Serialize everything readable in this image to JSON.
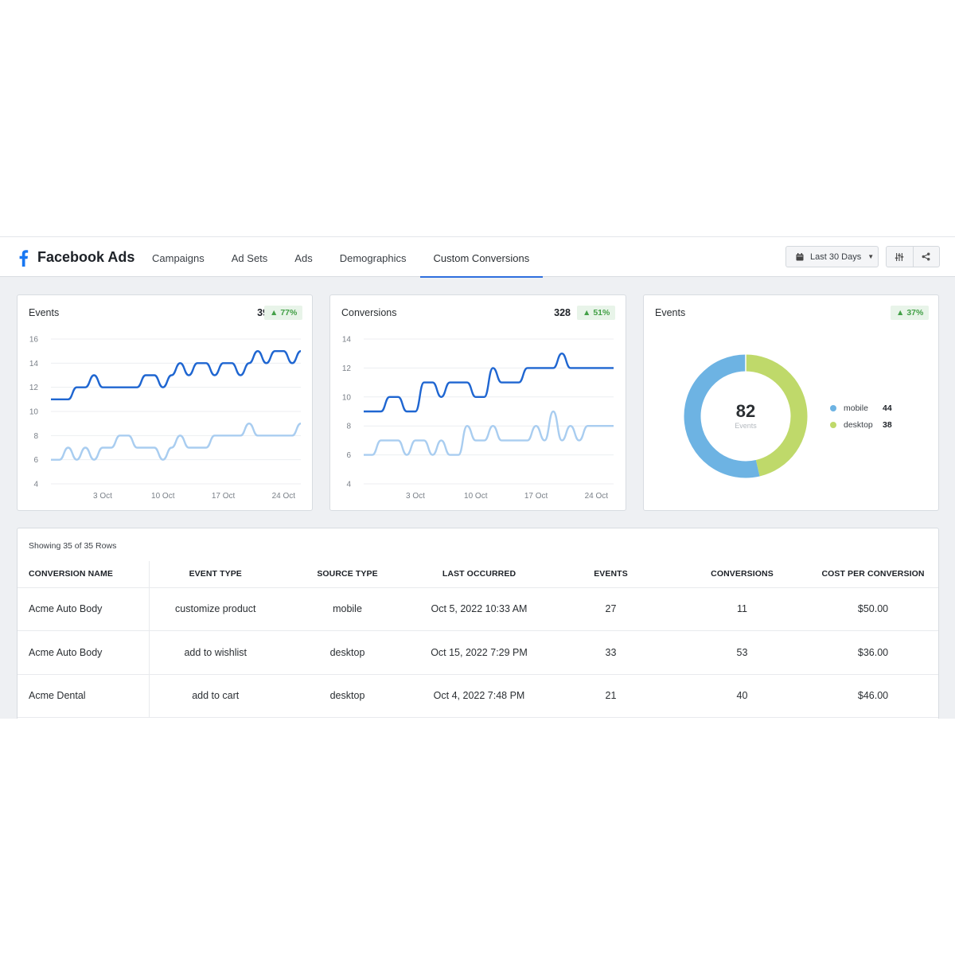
{
  "header": {
    "brand": "Facebook Ads",
    "tabs": [
      {
        "label": "Campaigns",
        "active": false
      },
      {
        "label": "Ad Sets",
        "active": false
      },
      {
        "label": "Ads",
        "active": false
      },
      {
        "label": "Demographics",
        "active": false
      },
      {
        "label": "Custom Conversions",
        "active": true
      }
    ],
    "date_range": "Last 30 Days",
    "icons": [
      "facebook-icon",
      "calendar-icon",
      "filter-sliders-icon",
      "share-icon"
    ]
  },
  "colors": {
    "accent": "#2f6fde",
    "series_primary": "#1f66d1",
    "series_secondary": "#a9cdf0",
    "mobile": "#6db3e3",
    "desktop": "#bfd96a",
    "positive": "#43a047"
  },
  "cards": {
    "events": {
      "title": "Events",
      "value": "392",
      "change": "77%"
    },
    "conversions": {
      "title": "Conversions",
      "value": "328",
      "change": "51%"
    },
    "events_donut": {
      "title": "Events",
      "change": "37%",
      "total": "82",
      "total_label": "Events"
    }
  },
  "chart_data": [
    {
      "type": "line",
      "title": "Events",
      "x_ticks": [
        "3 Oct",
        "10 Oct",
        "17 Oct",
        "24 Oct"
      ],
      "y_ticks": [
        4,
        6,
        8,
        10,
        12,
        14,
        16
      ],
      "ylim": [
        4,
        16
      ],
      "xlim": [
        "Sep 27",
        "Oct 26"
      ],
      "grid": true,
      "x": [
        "Sep 27",
        "Sep 28",
        "Sep 29",
        "Sep 30",
        "Oct 1",
        "Oct 2",
        "Oct 3",
        "Oct 4",
        "Oct 5",
        "Oct 6",
        "Oct 7",
        "Oct 8",
        "Oct 9",
        "Oct 10",
        "Oct 11",
        "Oct 12",
        "Oct 13",
        "Oct 14",
        "Oct 15",
        "Oct 16",
        "Oct 17",
        "Oct 18",
        "Oct 19",
        "Oct 20",
        "Oct 21",
        "Oct 22",
        "Oct 23",
        "Oct 24",
        "Oct 25",
        "Oct 26"
      ],
      "series": [
        {
          "values": [
            11,
            11,
            11,
            12,
            12,
            13,
            12,
            12,
            12,
            12,
            12,
            13,
            13,
            12,
            13,
            14,
            13,
            14,
            14,
            13,
            14,
            14,
            13,
            14,
            15,
            14,
            15,
            15,
            14,
            15
          ]
        },
        {
          "values": [
            6,
            6,
            7,
            6,
            7,
            6,
            7,
            7,
            8,
            8,
            7,
            7,
            7,
            6,
            7,
            8,
            7,
            7,
            7,
            8,
            8,
            8,
            8,
            9,
            8,
            8,
            8,
            8,
            8,
            9
          ]
        }
      ]
    },
    {
      "type": "line",
      "title": "Conversions",
      "x_ticks": [
        "3 Oct",
        "10 Oct",
        "17 Oct",
        "24 Oct"
      ],
      "y_ticks": [
        4,
        6,
        8,
        10,
        12,
        14
      ],
      "ylim": [
        4,
        14
      ],
      "xlim": [
        "Sep 27",
        "Oct 26"
      ],
      "grid": true,
      "x": [
        "Sep 27",
        "Sep 28",
        "Sep 29",
        "Sep 30",
        "Oct 1",
        "Oct 2",
        "Oct 3",
        "Oct 4",
        "Oct 5",
        "Oct 6",
        "Oct 7",
        "Oct 8",
        "Oct 9",
        "Oct 10",
        "Oct 11",
        "Oct 12",
        "Oct 13",
        "Oct 14",
        "Oct 15",
        "Oct 16",
        "Oct 17",
        "Oct 18",
        "Oct 19",
        "Oct 20",
        "Oct 21",
        "Oct 22",
        "Oct 23",
        "Oct 24",
        "Oct 25",
        "Oct 26"
      ],
      "series": [
        {
          "values": [
            9,
            9,
            9,
            10,
            10,
            9,
            9,
            11,
            11,
            10,
            11,
            11,
            11,
            10,
            10,
            12,
            11,
            11,
            11,
            12,
            12,
            12,
            12,
            13,
            12,
            12,
            12,
            12,
            12,
            12
          ]
        },
        {
          "values": [
            6,
            6,
            7,
            7,
            7,
            6,
            7,
            7,
            6,
            7,
            6,
            6,
            8,
            7,
            7,
            8,
            7,
            7,
            7,
            7,
            8,
            7,
            9,
            7,
            8,
            7,
            8,
            8,
            8,
            8
          ]
        }
      ]
    },
    {
      "type": "pie",
      "title": "Events",
      "categories": [
        "mobile",
        "desktop"
      ],
      "values": [
        44,
        38
      ],
      "legend": "right"
    }
  ],
  "table": {
    "showing": "Showing 35 of 35 Rows",
    "columns": [
      "CONVERSION NAME",
      "EVENT TYPE",
      "SOURCE TYPE",
      "LAST OCCURRED",
      "EVENTS",
      "CONVERSIONS",
      "COST PER CONVERSION"
    ],
    "rows": [
      [
        "Acme Auto Body",
        "customize product",
        "mobile",
        "Oct 5, 2022 10:33 AM",
        "27",
        "11",
        "$50.00"
      ],
      [
        "Acme Auto Body",
        "add to wishlist",
        "desktop",
        "Oct 15, 2022 7:29 PM",
        "33",
        "53",
        "$36.00"
      ],
      [
        "Acme Dental",
        "add to cart",
        "desktop",
        "Oct 4, 2022 7:48 PM",
        "21",
        "40",
        "$46.00"
      ]
    ]
  }
}
